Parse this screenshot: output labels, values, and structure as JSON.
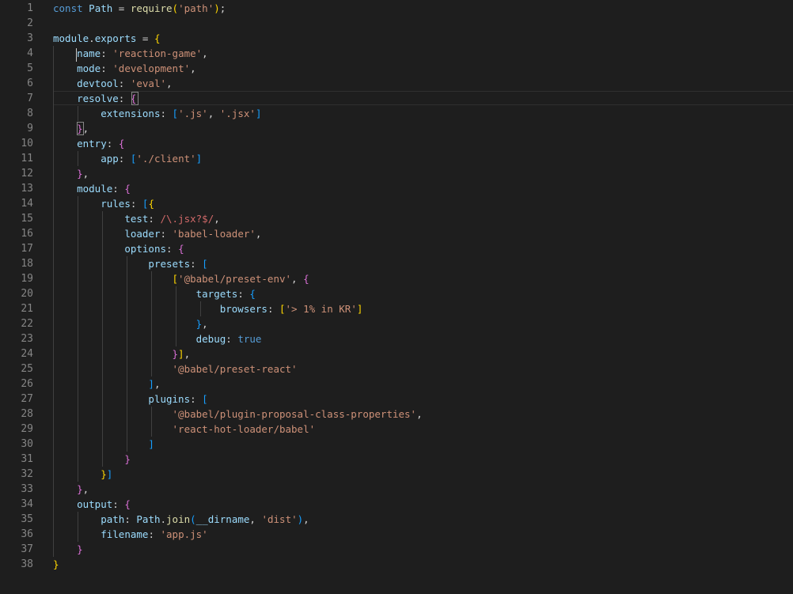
{
  "editor": {
    "language": "javascript",
    "theme": "dark",
    "current_line": 7,
    "line_count": 38,
    "lines": [
      [
        [
          "k",
          "const"
        ],
        [
          "p",
          " "
        ],
        [
          "v",
          "Path"
        ],
        [
          "p",
          " = "
        ],
        [
          "f",
          "require"
        ],
        [
          "b1",
          "("
        ],
        [
          "s",
          "'path'"
        ],
        [
          "b1",
          ")"
        ],
        [
          "p",
          ";"
        ]
      ],
      [],
      [
        [
          "v",
          "module"
        ],
        [
          "p",
          "."
        ],
        [
          "v",
          "exports"
        ],
        [
          "p",
          " = "
        ],
        [
          "b1",
          "{"
        ]
      ],
      [
        [
          "p",
          "    "
        ],
        [
          "v",
          "name"
        ],
        [
          "p",
          ": "
        ],
        [
          "s",
          "'reaction-game'"
        ],
        [
          "p",
          ","
        ]
      ],
      [
        [
          "p",
          "    "
        ],
        [
          "v",
          "mode"
        ],
        [
          "p",
          ": "
        ],
        [
          "s",
          "'development'"
        ],
        [
          "p",
          ","
        ]
      ],
      [
        [
          "p",
          "    "
        ],
        [
          "v",
          "devtool"
        ],
        [
          "p",
          ": "
        ],
        [
          "s",
          "'eval'"
        ],
        [
          "p",
          ","
        ]
      ],
      [
        [
          "p",
          "    "
        ],
        [
          "v",
          "resolve"
        ],
        [
          "p",
          ": "
        ],
        [
          "b2",
          "{"
        ]
      ],
      [
        [
          "p",
          "        "
        ],
        [
          "v",
          "extensions"
        ],
        [
          "p",
          ": "
        ],
        [
          "b3",
          "["
        ],
        [
          "s",
          "'.js'"
        ],
        [
          "p",
          ", "
        ],
        [
          "s",
          "'.jsx'"
        ],
        [
          "b3",
          "]"
        ]
      ],
      [
        [
          "p",
          "    "
        ],
        [
          "b2",
          "}"
        ],
        [
          "p",
          ","
        ]
      ],
      [
        [
          "p",
          "    "
        ],
        [
          "v",
          "entry"
        ],
        [
          "p",
          ": "
        ],
        [
          "b2",
          "{"
        ]
      ],
      [
        [
          "p",
          "        "
        ],
        [
          "v",
          "app"
        ],
        [
          "p",
          ": "
        ],
        [
          "b3",
          "["
        ],
        [
          "s",
          "'./client'"
        ],
        [
          "b3",
          "]"
        ]
      ],
      [
        [
          "p",
          "    "
        ],
        [
          "b2",
          "}"
        ],
        [
          "p",
          ","
        ]
      ],
      [
        [
          "p",
          "    "
        ],
        [
          "v",
          "module"
        ],
        [
          "p",
          ": "
        ],
        [
          "b2",
          "{"
        ]
      ],
      [
        [
          "p",
          "        "
        ],
        [
          "v",
          "rules"
        ],
        [
          "p",
          ": "
        ],
        [
          "b3",
          "["
        ],
        [
          "b1",
          "{"
        ]
      ],
      [
        [
          "p",
          "            "
        ],
        [
          "v",
          "test"
        ],
        [
          "p",
          ": "
        ],
        [
          "r",
          "/\\.jsx?$/"
        ],
        [
          "p",
          ","
        ]
      ],
      [
        [
          "p",
          "            "
        ],
        [
          "v",
          "loader"
        ],
        [
          "p",
          ": "
        ],
        [
          "s",
          "'babel-loader'"
        ],
        [
          "p",
          ","
        ]
      ],
      [
        [
          "p",
          "            "
        ],
        [
          "v",
          "options"
        ],
        [
          "p",
          ": "
        ],
        [
          "b2",
          "{"
        ]
      ],
      [
        [
          "p",
          "                "
        ],
        [
          "v",
          "presets"
        ],
        [
          "p",
          ": "
        ],
        [
          "b3",
          "["
        ]
      ],
      [
        [
          "p",
          "                    "
        ],
        [
          "b1",
          "["
        ],
        [
          "s",
          "'@babel/preset-env'"
        ],
        [
          "p",
          ", "
        ],
        [
          "b2",
          "{"
        ]
      ],
      [
        [
          "p",
          "                        "
        ],
        [
          "v",
          "targets"
        ],
        [
          "p",
          ": "
        ],
        [
          "b3",
          "{"
        ]
      ],
      [
        [
          "p",
          "                            "
        ],
        [
          "v",
          "browsers"
        ],
        [
          "p",
          ": "
        ],
        [
          "b1",
          "["
        ],
        [
          "s",
          "'> 1% in KR'"
        ],
        [
          "b1",
          "]"
        ]
      ],
      [
        [
          "p",
          "                        "
        ],
        [
          "b3",
          "}"
        ],
        [
          "p",
          ","
        ]
      ],
      [
        [
          "p",
          "                        "
        ],
        [
          "v",
          "debug"
        ],
        [
          "p",
          ": "
        ],
        [
          "k",
          "true"
        ]
      ],
      [
        [
          "p",
          "                    "
        ],
        [
          "b2",
          "}"
        ],
        [
          "b1",
          "]"
        ],
        [
          "p",
          ","
        ]
      ],
      [
        [
          "p",
          "                    "
        ],
        [
          "s",
          "'@babel/preset-react'"
        ]
      ],
      [
        [
          "p",
          "                "
        ],
        [
          "b3",
          "]"
        ],
        [
          "p",
          ","
        ]
      ],
      [
        [
          "p",
          "                "
        ],
        [
          "v",
          "plugins"
        ],
        [
          "p",
          ": "
        ],
        [
          "b3",
          "["
        ]
      ],
      [
        [
          "p",
          "                    "
        ],
        [
          "s",
          "'@babel/plugin-proposal-class-properties'"
        ],
        [
          "p",
          ","
        ]
      ],
      [
        [
          "p",
          "                    "
        ],
        [
          "s",
          "'react-hot-loader/babel'"
        ]
      ],
      [
        [
          "p",
          "                "
        ],
        [
          "b3",
          "]"
        ]
      ],
      [
        [
          "p",
          "            "
        ],
        [
          "b2",
          "}"
        ]
      ],
      [
        [
          "p",
          "        "
        ],
        [
          "b1",
          "}"
        ],
        [
          "b3",
          "]"
        ]
      ],
      [
        [
          "p",
          "    "
        ],
        [
          "b2",
          "}"
        ],
        [
          "p",
          ","
        ]
      ],
      [
        [
          "p",
          "    "
        ],
        [
          "v",
          "output"
        ],
        [
          "p",
          ": "
        ],
        [
          "b2",
          "{"
        ]
      ],
      [
        [
          "p",
          "        "
        ],
        [
          "v",
          "path"
        ],
        [
          "p",
          ": "
        ],
        [
          "v",
          "Path"
        ],
        [
          "p",
          "."
        ],
        [
          "f",
          "join"
        ],
        [
          "b3",
          "("
        ],
        [
          "v",
          "__dirname"
        ],
        [
          "p",
          ", "
        ],
        [
          "s",
          "'dist'"
        ],
        [
          "b3",
          ")"
        ],
        [
          "p",
          ","
        ]
      ],
      [
        [
          "p",
          "        "
        ],
        [
          "v",
          "filename"
        ],
        [
          "p",
          ": "
        ],
        [
          "s",
          "'app.js'"
        ]
      ],
      [
        [
          "p",
          "    "
        ],
        [
          "b2",
          "}"
        ]
      ],
      [
        [
          "b1",
          "}"
        ]
      ]
    ]
  }
}
